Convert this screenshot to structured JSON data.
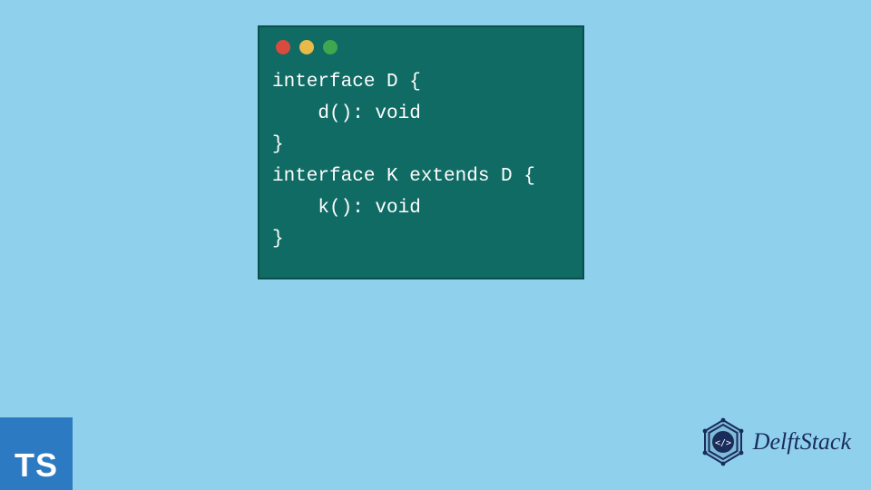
{
  "code_window": {
    "traffic_lights": [
      "red",
      "yellow",
      "green"
    ],
    "code": "interface D {\n    d(): void\n}\ninterface K extends D {\n    k(): void\n}"
  },
  "ts_badge": {
    "label": "TS"
  },
  "brand": {
    "name": "DelftStack"
  },
  "colors": {
    "background": "#8fd1ed",
    "window_bg": "#0f6b63",
    "window_border": "#0a4f49",
    "ts_badge_bg": "#2b7ac2",
    "brand_text": "#1a2d5a"
  }
}
